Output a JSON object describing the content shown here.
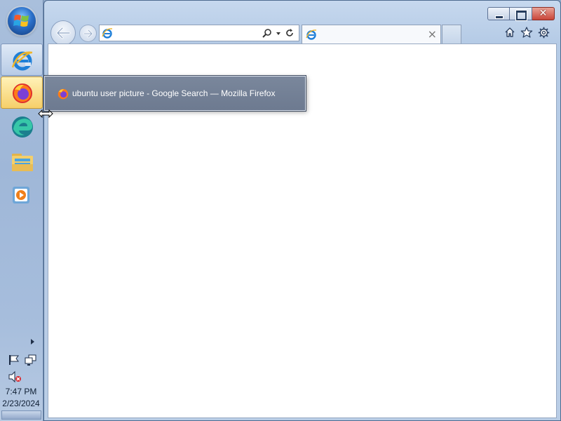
{
  "taskbar": {
    "pinned": [
      {
        "name": "Internet Explorer",
        "icon": "internet-explorer-icon"
      },
      {
        "name": "Mozilla Firefox",
        "icon": "firefox-icon"
      },
      {
        "name": "Microsoft Edge",
        "icon": "edge-icon"
      },
      {
        "name": "File Explorer",
        "icon": "folder-icon"
      },
      {
        "name": "Windows Media Player",
        "icon": "media-player-icon"
      }
    ],
    "clock": {
      "time": "7:47 PM",
      "date": "2/23/2024"
    }
  },
  "thumbnail_popup": {
    "title": "ubuntu user picture - Google Search — Mozilla Firefox",
    "icon": "firefox-icon"
  },
  "browser": {
    "address": {
      "value": "",
      "placeholder": ""
    },
    "tab": {
      "title": "",
      "close_label": "×"
    },
    "caption": {
      "close_label": "✕"
    },
    "colors": {
      "window_frame": "#b9cde6",
      "close_button": "#c9463a",
      "popup_background": "#6d7a90",
      "firefox_taskbar_highlight": "#f6cf6a"
    }
  }
}
